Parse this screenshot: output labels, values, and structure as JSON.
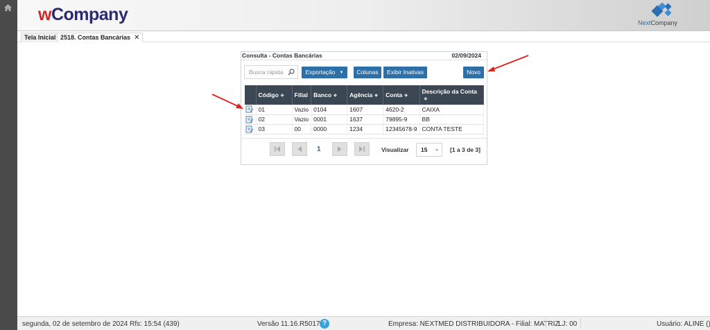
{
  "header": {
    "logo_w": "w",
    "logo_rest": "Company",
    "partner_next": "Next",
    "partner_company": "Company"
  },
  "tabs": [
    {
      "label": "Tela Inicial"
    },
    {
      "label": "2518. Contas Bancárias",
      "close": "✕"
    }
  ],
  "panel": {
    "title": "Consulta - Contas Bancárias",
    "date": "02/09/2024",
    "search_placeholder": "Busca rápida",
    "export_label": "Exportação",
    "columns_label": "Colunas",
    "inactive_label": "Exibir Inativas",
    "new_label": "Novo"
  },
  "table": {
    "headers": [
      "Código",
      "Filial",
      "Banco",
      "Agência",
      "Conta",
      "Descrição da Conta"
    ],
    "rows": [
      [
        "01",
        "Vazio",
        "0104",
        "1607",
        "4620-2",
        "CAIXA"
      ],
      [
        "02",
        "Vazio",
        "0001",
        "1637",
        "79895-9",
        "BB"
      ],
      [
        "03",
        "00",
        "0000",
        "1234",
        "12345678-9",
        "CONTA TESTE"
      ]
    ]
  },
  "pager": {
    "current_page": "1",
    "view_label": "Visualizar",
    "page_size": "15",
    "range": "[1 a 3 de 3]"
  },
  "footer": {
    "date": "segunda, 02 de setembro de 2024  Rfs: 15:54 (439)",
    "version": "Versão 11.16.R5017",
    "help": "?",
    "company": "Empresa: NEXTMED DISTRIBUIDORA - Filial: MATRIZ",
    "lj": "LJ: 00",
    "user": "Usuário: ALINE ()"
  },
  "colors": {
    "accent": "#2d6fa7",
    "header_dark": "#3c4754",
    "arrow": "#e0201c"
  }
}
